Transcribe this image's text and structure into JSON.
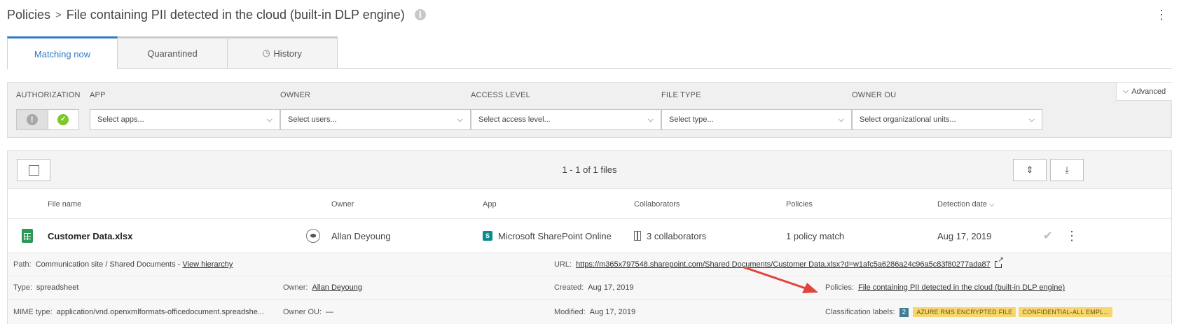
{
  "breadcrumb": {
    "root": "Policies",
    "separator": ">",
    "title": "File containing PII detected in the cloud (built-in DLP engine)"
  },
  "tabs": [
    {
      "label": "Matching now",
      "active": true
    },
    {
      "label": "Quarantined",
      "active": false
    },
    {
      "label": "History",
      "active": false
    }
  ],
  "filters": {
    "authorization_label": "AUTHORIZATION",
    "app": {
      "label": "APP",
      "placeholder": "Select apps..."
    },
    "owner": {
      "label": "OWNER",
      "placeholder": "Select users..."
    },
    "access_level": {
      "label": "ACCESS LEVEL",
      "placeholder": "Select access level..."
    },
    "file_type": {
      "label": "FILE TYPE",
      "placeholder": "Select type..."
    },
    "owner_ou": {
      "label": "OWNER OU",
      "placeholder": "Select organizational units..."
    },
    "advanced": "Advanced"
  },
  "table": {
    "count_text": "1 - 1 of 1 files",
    "columns": [
      "File name",
      "Owner",
      "App",
      "Collaborators",
      "Policies",
      "Detection date"
    ],
    "row": {
      "file_name": "Customer Data.xlsx",
      "owner": "Allan Deyoung",
      "app": "Microsoft SharePoint Online",
      "collaborators": "3 collaborators",
      "policies": "1 policy match",
      "detection_date": "Aug 17, 2019"
    }
  },
  "details": {
    "path_label": "Path:",
    "path_value": "Communication site / Shared Documents -",
    "view_hierarchy": "View hierarchy",
    "url_label": "URL:",
    "url_value": "https://m365x797548.sharepoint.com/Shared Documents/Customer Data.xlsx?d=w1afc5a6286a24c96a5c83f80277ada87",
    "type_label": "Type:",
    "type_value": "spreadsheet",
    "owner_label": "Owner:",
    "owner_value": "Allan Deyoung",
    "created_label": "Created:",
    "created_value": "Aug 17, 2019",
    "policies_label": "Policies:",
    "policies_value": "File containing PII detected in the cloud (built-in DLP engine)",
    "mime_label": "MIME type:",
    "mime_value": "application/vnd.openxmlformats-officedocument.spreadshe...",
    "owner_ou_label": "Owner OU:",
    "owner_ou_value": "—",
    "modified_label": "Modified:",
    "modified_value": "Aug 17, 2019",
    "classification_label": "Classification labels:",
    "classification_count": "2",
    "classification_values": [
      "AZURE RMS ENCRYPTED FILE",
      "CONFIDENTIAL-ALL EMPL..."
    ]
  },
  "colors": {
    "accent": "#2d7bc3",
    "excel_green": "#2b9a57",
    "label_yellow": "#f7d76b",
    "arrow_red": "#e0443a"
  }
}
